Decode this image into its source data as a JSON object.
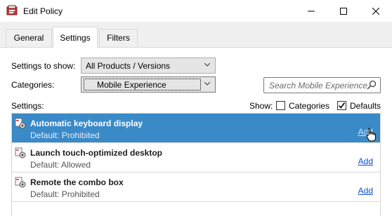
{
  "window": {
    "title": "Edit Policy"
  },
  "tabs": [
    {
      "label": "General"
    },
    {
      "label": "Settings"
    },
    {
      "label": "Filters"
    }
  ],
  "active_tab": "Settings",
  "filters": {
    "show_label": "Settings to show:",
    "show_value": "All Products / Versions",
    "categories_label": "Categories:",
    "categories_value": "Mobile Experience",
    "search_placeholder": "Search Mobile Experience",
    "settings_label": "Settings:",
    "show_toggle_label": "Show:",
    "categories_checkbox_label": "Categories",
    "categories_checked": false,
    "defaults_checkbox_label": "Defaults",
    "defaults_checked": true
  },
  "settings": [
    {
      "name": "Automatic keyboard display",
      "default": "Default: Prohibited",
      "action": "Add",
      "selected": true
    },
    {
      "name": "Launch touch-optimized desktop",
      "default": "Default: Allowed",
      "action": "Add",
      "selected": false
    },
    {
      "name": "Remote the combo box",
      "default": "Default: Prohibited",
      "action": "Add",
      "selected": false
    }
  ],
  "colors": {
    "selection": "#3a8ac8",
    "link": "#0b4fd0"
  }
}
